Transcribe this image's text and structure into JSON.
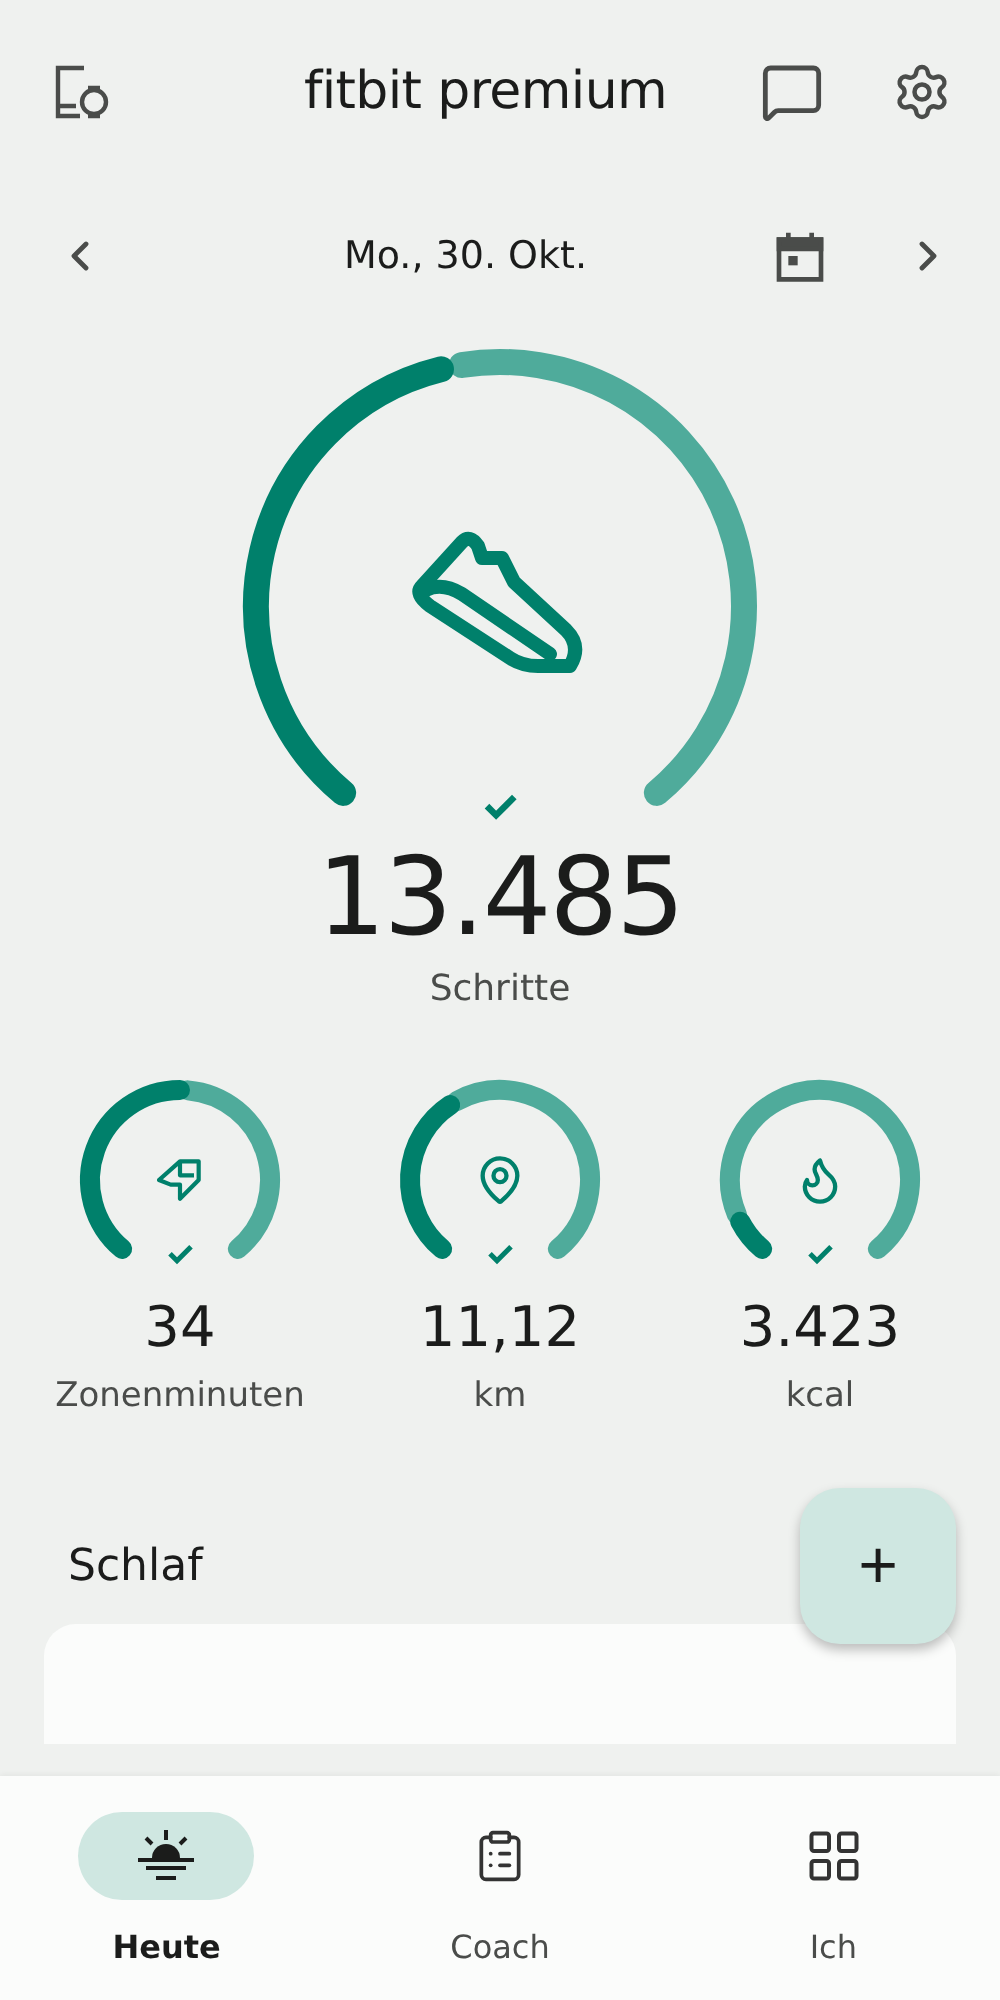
{
  "header": {
    "title": "fitbit premium"
  },
  "date_bar": {
    "date": "Mo., 30. Okt."
  },
  "main_stat": {
    "value": "13.485",
    "label": "Schritte",
    "goal_met": true
  },
  "stats": [
    {
      "kind": "zone",
      "value": "34",
      "label": "Zonenminuten",
      "goal_met": true
    },
    {
      "kind": "distance",
      "value": "11,12",
      "label": "km",
      "goal_met": true
    },
    {
      "kind": "calories",
      "value": "3.423",
      "label": "kcal",
      "goal_met": true
    }
  ],
  "section": {
    "title": "Schlaf"
  },
  "fab": {
    "label": "+"
  },
  "nav": [
    {
      "kind": "today",
      "label": "Heute",
      "selected": true
    },
    {
      "kind": "coach",
      "label": "Coach",
      "selected": false
    },
    {
      "kind": "me",
      "label": "Ich",
      "selected": false
    }
  ]
}
